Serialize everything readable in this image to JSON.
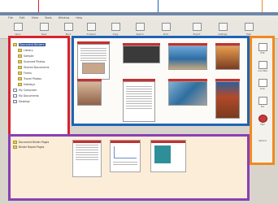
{
  "window": {
    "menu": [
      "File",
      "Edit",
      "View",
      "Tools",
      "Window",
      "Help"
    ]
  },
  "toolbar": {
    "buttons": [
      {
        "label": "Open",
        "icon": "folder-icon"
      },
      {
        "label": "Save",
        "icon": "save-icon"
      },
      {
        "label": "Back",
        "icon": "back-arrow-icon"
      },
      {
        "label": "Forward",
        "icon": "forward-arrow-icon"
      },
      {
        "label": "Copy",
        "icon": "copy-icon"
      },
      {
        "label": "Search",
        "icon": "search-icon"
      },
      {
        "label": "Print",
        "icon": "print-icon"
      },
      {
        "label": "Export",
        "icon": "export-icon"
      },
      {
        "label": "Settings",
        "icon": "gear-icon"
      },
      {
        "label": "Help",
        "icon": "help-icon"
      }
    ]
  },
  "tree": {
    "items": [
      {
        "label": "Document Binders",
        "icon": "folder-icon",
        "selected": true
      },
      {
        "label": "Library",
        "icon": "folder-icon"
      },
      {
        "label": "Sample",
        "icon": "folder-icon"
      },
      {
        "label": "Scanned Photos",
        "icon": "folder-icon"
      },
      {
        "label": "Shared Documents",
        "icon": "folder-icon"
      },
      {
        "label": "Forms",
        "icon": "folder-icon"
      },
      {
        "label": "Travel Photos",
        "icon": "folder-icon"
      },
      {
        "label": "Holidays",
        "icon": "folder-icon"
      },
      {
        "label": "My Computer",
        "icon": "computer-icon"
      },
      {
        "label": "My Documents",
        "icon": "document-icon"
      },
      {
        "label": "Desktop",
        "icon": "desktop-icon"
      }
    ]
  },
  "tools": {
    "items": [
      {
        "label": "Edit",
        "icon": "pencil-icon"
      },
      {
        "label": "Annotate",
        "icon": "annotate-icon"
      },
      {
        "label": "Scan",
        "icon": "scanner-icon"
      },
      {
        "label": "Fax",
        "icon": "fax-icon"
      },
      {
        "label": "Mail",
        "icon": "mail-icon"
      },
      {
        "label": "Options",
        "icon": "options-icon"
      }
    ]
  },
  "binder": {
    "items": [
      {
        "label": "Document Binder Pages"
      },
      {
        "label": "Binder Report Pages"
      }
    ]
  },
  "colors": {
    "tree_frame": "#d8232f",
    "viewer_frame": "#1f63b6",
    "tools_frame": "#ef8a1f",
    "binder_frame": "#8a3fb3"
  }
}
